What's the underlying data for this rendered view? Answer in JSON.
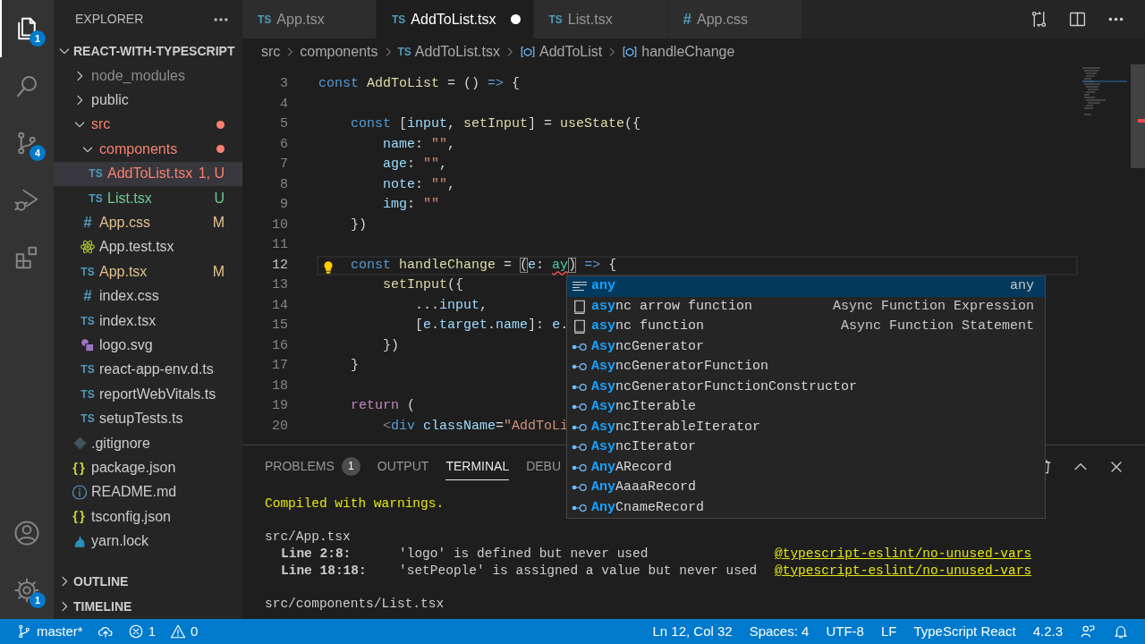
{
  "activity_bar": {
    "items": [
      {
        "kind": "explorer",
        "selected": true,
        "badge": "1"
      },
      {
        "kind": "search",
        "selected": false
      },
      {
        "kind": "source-control",
        "selected": false,
        "badge": "4"
      },
      {
        "kind": "run-debug",
        "selected": false
      },
      {
        "kind": "extensions",
        "selected": false
      }
    ],
    "bottom": [
      {
        "kind": "account"
      },
      {
        "kind": "settings",
        "badge": "1"
      }
    ]
  },
  "sidebar": {
    "title": "EXPLORER",
    "sections": [
      {
        "title": "REACT-WITH-TYPESCRIPT",
        "expanded": true,
        "tree": [
          {
            "name": "node_modules",
            "kind": "folder",
            "expanded": false,
            "selected": false,
            "color": "#8c8c8c"
          },
          {
            "name": "public",
            "kind": "folder",
            "expanded": false,
            "selected": false
          },
          {
            "name": "src",
            "kind": "folder",
            "expanded": true,
            "selected": false,
            "color": "#f88070",
            "dot": true,
            "children": [
              {
                "name": "components",
                "kind": "folder",
                "expanded": true,
                "selected": false,
                "color": "#f88070",
                "dot": true,
                "children": [
                  {
                    "name": "AddToList.tsx",
                    "kind": "ts",
                    "glyph": "TS",
                    "selected": true,
                    "color": "#f88070",
                    "badge": "1, U"
                  },
                  {
                    "name": "List.tsx",
                    "kind": "ts",
                    "glyph": "TS",
                    "selected": false,
                    "color": "#73c991",
                    "badge": "U"
                  }
                ]
              },
              {
                "name": "App.css",
                "kind": "css",
                "glyph": "#",
                "selected": false,
                "color": "#e2c08d",
                "badge": "M"
              },
              {
                "name": "App.test.tsx",
                "kind": "react",
                "selected": false
              },
              {
                "name": "App.tsx",
                "kind": "ts",
                "glyph": "TS",
                "selected": false,
                "color": "#e2c08d",
                "badge": "M"
              },
              {
                "name": "index.css",
                "kind": "css",
                "glyph": "#",
                "selected": false
              },
              {
                "name": "index.tsx",
                "kind": "ts",
                "glyph": "TS",
                "selected": false
              },
              {
                "name": "logo.svg",
                "kind": "svg",
                "selected": false
              },
              {
                "name": "react-app-env.d.ts",
                "kind": "ts",
                "glyph": "TS",
                "selected": false
              },
              {
                "name": "reportWebVitals.ts",
                "kind": "ts",
                "glyph": "TS",
                "selected": false
              },
              {
                "name": "setupTests.ts",
                "kind": "ts",
                "glyph": "TS",
                "selected": false
              }
            ]
          },
          {
            "name": ".gitignore",
            "kind": "git",
            "selected": false
          },
          {
            "name": "package.json",
            "kind": "json",
            "glyph": "{}",
            "selected": false
          },
          {
            "name": "README.md",
            "kind": "info",
            "selected": false
          },
          {
            "name": "tsconfig.json",
            "kind": "json",
            "glyph": "{}",
            "selected": false
          },
          {
            "name": "yarn.lock",
            "kind": "yarn",
            "selected": false
          }
        ]
      },
      {
        "title": "OUTLINE",
        "expanded": false
      },
      {
        "title": "TIMELINE",
        "expanded": false
      }
    ]
  },
  "editor_tabs": [
    {
      "label": "App.tsx",
      "kind": "ts",
      "glyph": "TS",
      "selected": false,
      "dirty": false
    },
    {
      "label": "AddToList.tsx",
      "kind": "ts",
      "glyph": "TS",
      "selected": true,
      "dirty": true
    },
    {
      "label": "List.tsx",
      "kind": "ts",
      "glyph": "TS",
      "selected": false,
      "dirty": false
    },
    {
      "label": "App.css",
      "kind": "css",
      "glyph": "#",
      "selected": false,
      "dirty": false
    }
  ],
  "editor_actions": [
    {
      "kind": "compare"
    },
    {
      "kind": "split"
    },
    {
      "kind": "more"
    }
  ],
  "breadcrumb": [
    {
      "label": "src",
      "kind": "text"
    },
    {
      "label": "components",
      "kind": "text"
    },
    {
      "label": "AddToList.tsx",
      "kind": "ts",
      "glyph": "TS"
    },
    {
      "label": "AddToList",
      "kind": "symbol"
    },
    {
      "label": "handleChange",
      "kind": "symbol"
    }
  ],
  "editor": {
    "lines": [
      {
        "number": "3",
        "current": false,
        "lightbulb": false,
        "tokens": [
          {
            "kind": "kw",
            "text": "const"
          },
          {
            "kind": "fn",
            "text": " AddToList"
          },
          {
            "kind": "p",
            "text": " = () "
          },
          {
            "kind": "kw",
            "text": "=>"
          },
          {
            "kind": "p",
            "text": " {"
          }
        ]
      },
      {
        "number": "4",
        "current": false,
        "lightbulb": false
      },
      {
        "number": "5",
        "current": false,
        "lightbulb": false,
        "tokens": [
          {
            "kind": "kw",
            "text": "    const"
          },
          {
            "kind": "p",
            "text": " ["
          },
          {
            "kind": "var",
            "text": "input"
          },
          {
            "kind": "p",
            "text": ", "
          },
          {
            "kind": "fn",
            "text": "setInput"
          },
          {
            "kind": "p",
            "text": "] = "
          },
          {
            "kind": "fn",
            "text": "useState"
          },
          {
            "kind": "p",
            "text": "({"
          }
        ]
      },
      {
        "number": "6",
        "current": false,
        "lightbulb": false,
        "tokens": [
          {
            "kind": "var",
            "text": "        name"
          },
          {
            "kind": "p",
            "text": ": "
          },
          {
            "kind": "str",
            "text": "\"\""
          },
          {
            "kind": "p",
            "text": ","
          }
        ]
      },
      {
        "number": "7",
        "current": false,
        "lightbulb": false,
        "tokens": [
          {
            "kind": "var",
            "text": "        age"
          },
          {
            "kind": "p",
            "text": ": "
          },
          {
            "kind": "str",
            "text": "\"\""
          },
          {
            "kind": "p",
            "text": ","
          }
        ]
      },
      {
        "number": "8",
        "current": false,
        "lightbulb": false,
        "tokens": [
          {
            "kind": "var",
            "text": "        note"
          },
          {
            "kind": "p",
            "text": ": "
          },
          {
            "kind": "str",
            "text": "\"\""
          },
          {
            "kind": "p",
            "text": ","
          }
        ]
      },
      {
        "number": "9",
        "current": false,
        "lightbulb": false,
        "tokens": [
          {
            "kind": "var",
            "text": "        img"
          },
          {
            "kind": "p",
            "text": ": "
          },
          {
            "kind": "str",
            "text": "\"\""
          }
        ]
      },
      {
        "number": "10",
        "current": false,
        "lightbulb": false,
        "tokens": [
          {
            "kind": "p",
            "text": "    })"
          }
        ]
      },
      {
        "number": "11",
        "current": false,
        "lightbulb": false
      },
      {
        "number": "12",
        "current": true,
        "lightbulb": true,
        "tokens": [
          {
            "kind": "kw",
            "text": "    const"
          },
          {
            "kind": "fn",
            "text": " handleChange"
          },
          {
            "kind": "p",
            "text": " = "
          },
          {
            "kind": "bracket",
            "text": "("
          },
          {
            "kind": "var",
            "text": "e"
          },
          {
            "kind": "p",
            "text": ": "
          },
          {
            "kind": "type-error",
            "text": "ay"
          },
          {
            "kind": "bracket",
            "text": ")"
          },
          {
            "kind": "kw",
            "text": " =>"
          },
          {
            "kind": "p",
            "text": " {"
          }
        ]
      },
      {
        "number": "13",
        "current": false,
        "lightbulb": false,
        "tokens": [
          {
            "kind": "fn",
            "text": "        setInput"
          },
          {
            "kind": "p",
            "text": "({"
          }
        ]
      },
      {
        "number": "14",
        "current": false,
        "lightbulb": false,
        "tokens": [
          {
            "kind": "p",
            "text": "            ..."
          },
          {
            "kind": "var",
            "text": "input"
          },
          {
            "kind": "p",
            "text": ","
          }
        ]
      },
      {
        "number": "15",
        "current": false,
        "lightbulb": false,
        "tokens": [
          {
            "kind": "p",
            "text": "            ["
          },
          {
            "kind": "var",
            "text": "e"
          },
          {
            "kind": "p",
            "text": "."
          },
          {
            "kind": "var",
            "text": "target"
          },
          {
            "kind": "p",
            "text": "."
          },
          {
            "kind": "var",
            "text": "name"
          },
          {
            "kind": "p",
            "text": "]: "
          },
          {
            "kind": "var",
            "text": "e"
          },
          {
            "kind": "p",
            "text": "."
          }
        ]
      },
      {
        "number": "16",
        "current": false,
        "lightbulb": false,
        "tokens": [
          {
            "kind": "p",
            "text": "        })"
          }
        ]
      },
      {
        "number": "17",
        "current": false,
        "lightbulb": false,
        "tokens": [
          {
            "kind": "p",
            "text": "    }"
          }
        ]
      },
      {
        "number": "18",
        "current": false,
        "lightbulb": false
      },
      {
        "number": "19",
        "current": false,
        "lightbulb": false,
        "tokens": [
          {
            "kind": "ctrl",
            "text": "    return"
          },
          {
            "kind": "p",
            "text": " ("
          }
        ]
      },
      {
        "number": "20",
        "current": false,
        "lightbulb": false,
        "tokens": [
          {
            "kind": "punct",
            "text": "        <"
          },
          {
            "kind": "tag",
            "text": "div"
          },
          {
            "kind": "attr",
            "text": " className"
          },
          {
            "kind": "p",
            "text": "="
          },
          {
            "kind": "str",
            "text": "\"AddToLi"
          }
        ]
      }
    ]
  },
  "suggestions": [
    {
      "kind": "keyword",
      "selected": true,
      "parts": [
        {
          "text": "any",
          "match": true
        }
      ],
      "detail": "any"
    },
    {
      "kind": "snippet",
      "selected": false,
      "parts": [
        {
          "text": "a",
          "match": true
        },
        {
          "text": "sy",
          "match": true
        },
        {
          "text": "nc arrow function",
          "match": false
        }
      ],
      "detail": "Async Function Expression"
    },
    {
      "kind": "snippet",
      "selected": false,
      "parts": [
        {
          "text": "a",
          "match": true
        },
        {
          "text": "sy",
          "match": true
        },
        {
          "text": "nc function",
          "match": false
        }
      ],
      "detail": "Async Function Statement"
    },
    {
      "kind": "interface",
      "selected": false,
      "parts": [
        {
          "text": "Asy",
          "match": true
        },
        {
          "text": "ncGenerator",
          "match": false
        }
      ]
    },
    {
      "kind": "interface",
      "selected": false,
      "parts": [
        {
          "text": "Asy",
          "match": true
        },
        {
          "text": "ncGeneratorFunction",
          "match": false
        }
      ]
    },
    {
      "kind": "interface",
      "selected": false,
      "parts": [
        {
          "text": "Asy",
          "match": true
        },
        {
          "text": "ncGeneratorFunctionConstructor",
          "match": false
        }
      ]
    },
    {
      "kind": "interface",
      "selected": false,
      "parts": [
        {
          "text": "Asy",
          "match": true
        },
        {
          "text": "ncIterable",
          "match": false
        }
      ]
    },
    {
      "kind": "interface",
      "selected": false,
      "parts": [
        {
          "text": "Asy",
          "match": true
        },
        {
          "text": "ncIterableIterator",
          "match": false
        }
      ]
    },
    {
      "kind": "interface",
      "selected": false,
      "parts": [
        {
          "text": "Asy",
          "match": true
        },
        {
          "text": "ncIterator",
          "match": false
        }
      ]
    },
    {
      "kind": "interface",
      "selected": false,
      "parts": [
        {
          "text": "Any",
          "match": true
        },
        {
          "text": "ARecord",
          "match": false
        }
      ]
    },
    {
      "kind": "interface",
      "selected": false,
      "parts": [
        {
          "text": "Any",
          "match": true
        },
        {
          "text": "AaaaRecord",
          "match": false
        }
      ]
    },
    {
      "kind": "interface",
      "selected": false,
      "parts": [
        {
          "text": "Any",
          "match": true
        },
        {
          "text": "CnameRecord",
          "match": false
        }
      ]
    }
  ],
  "panel": {
    "tabs": [
      {
        "label": "PROBLEMS",
        "badge": "1",
        "selected": false
      },
      {
        "label": "OUTPUT",
        "selected": false
      },
      {
        "label": "TERMINAL",
        "selected": true
      },
      {
        "label": "DEBU",
        "selected": false
      }
    ],
    "actions": [
      {
        "kind": "trash"
      },
      {
        "kind": "chevron-up"
      },
      {
        "kind": "close"
      }
    ],
    "terminal": [
      {
        "kind": "heading",
        "text": "Compiled with warnings."
      },
      {
        "kind": "blank"
      },
      {
        "kind": "file",
        "text": "src/App.tsx"
      },
      {
        "kind": "warning",
        "location": "Line 2:8:",
        "message": "'logo' is defined but never used",
        "rule": "@typescript-eslint/no-unused-vars"
      },
      {
        "kind": "warning",
        "location": "Line 18:18:",
        "message": "'setPeople' is assigned a value but never used",
        "rule": "@typescript-eslint/no-unused-vars"
      },
      {
        "kind": "blank"
      },
      {
        "kind": "file",
        "text": "src/components/List.tsx"
      }
    ]
  },
  "status_bar": {
    "left": [
      {
        "kind": "branch",
        "text": "master*"
      },
      {
        "kind": "cloud-upload"
      },
      {
        "kind": "error",
        "text": "1"
      },
      {
        "kind": "warning",
        "text": "0"
      }
    ],
    "right": [
      {
        "kind": "text",
        "text": "Ln 12, Col 32"
      },
      {
        "kind": "text",
        "text": "Spaces: 4"
      },
      {
        "kind": "text",
        "text": "UTF-8"
      },
      {
        "kind": "text",
        "text": "LF"
      },
      {
        "kind": "text",
        "text": "TypeScript React"
      },
      {
        "kind": "text",
        "text": "4.2.3"
      },
      {
        "kind": "feedback"
      },
      {
        "kind": "bell"
      }
    ]
  }
}
